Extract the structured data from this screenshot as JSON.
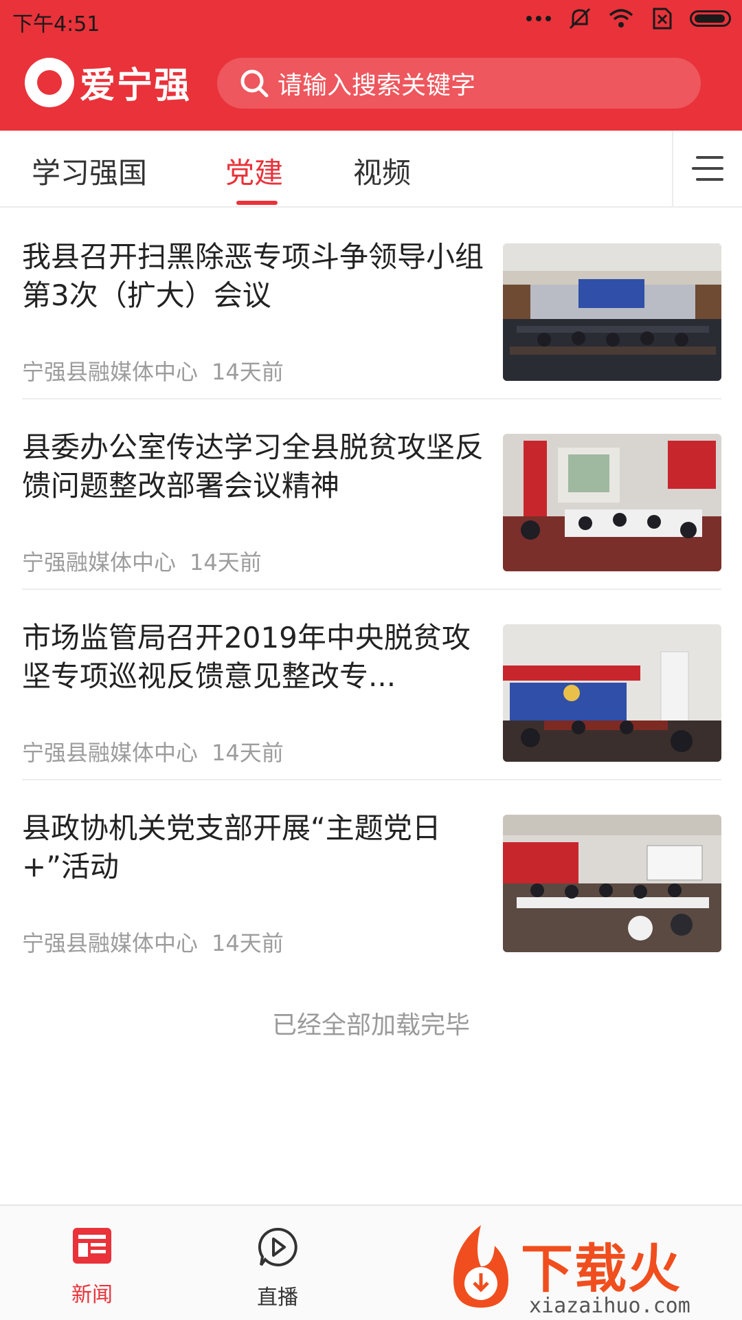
{
  "status_bar": {
    "time": "下午4:51"
  },
  "header": {
    "logo_text": "爱宁强",
    "search_placeholder": "请输入搜索关键字",
    "accent_color": "#e9323a"
  },
  "tabs": [
    {
      "label": "学习强国",
      "active": false
    },
    {
      "label": "党建",
      "active": true
    },
    {
      "label": "视频",
      "active": false
    }
  ],
  "news": [
    {
      "title": "我县召开扫黑除恶专项斗争领导小组第3次（扩大）会议",
      "source": "宁强县融媒体中心",
      "time": "14天前"
    },
    {
      "title": "县委办公室传达学习全县脱贫攻坚反馈问题整改部署会议精神",
      "source": "宁强融媒体中心",
      "time": "14天前"
    },
    {
      "title": "市场监管局召开2019年中央脱贫攻坚专项巡视反馈意见整改专...",
      "source": "宁强县融媒体中心",
      "time": "14天前"
    },
    {
      "title": "县政协机关党支部开展“主题党日+”活动",
      "source": "宁强县融媒体中心",
      "time": "14天前"
    }
  ],
  "end_text": "已经全部加载完毕",
  "bottom_nav": [
    {
      "label": "新闻",
      "icon": "news-icon",
      "active": true
    },
    {
      "label": "直播",
      "icon": "play-icon",
      "active": false
    }
  ],
  "watermark": {
    "text": "下载火",
    "url": "xiazaihuo.com"
  }
}
